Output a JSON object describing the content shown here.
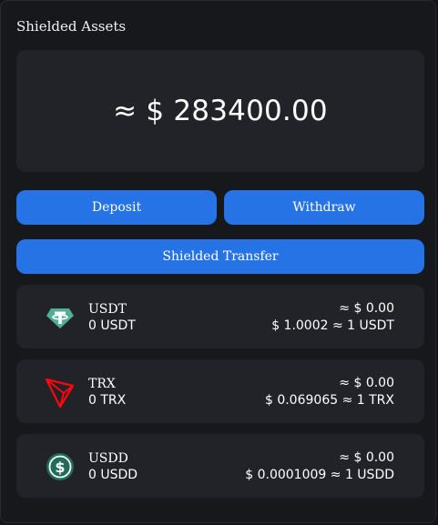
{
  "header": {
    "title": "Shielded Assets"
  },
  "balance": {
    "total": "≈ $ 283400.00"
  },
  "actions": {
    "deposit_label": "Deposit",
    "withdraw_label": "Withdraw",
    "transfer_label": "Shielded Transfer"
  },
  "colors": {
    "accent": "#2673e6",
    "card": "#212329",
    "background": "#17181c",
    "usdt_green": "#50af95",
    "trx_red": "#ff060a",
    "usdd_green": "#216c58"
  },
  "assets": [
    {
      "icon": "tether-icon",
      "symbol": "USDT",
      "balance": "0 USDT",
      "value": "≈ $ 0.00",
      "rate": "$ 1.0002 ≈ 1 USDT"
    },
    {
      "icon": "tron-icon",
      "symbol": "TRX",
      "balance": "0 TRX",
      "value": "≈ $ 0.00",
      "rate": "$ 0.069065 ≈ 1 TRX"
    },
    {
      "icon": "usdd-icon",
      "symbol": "USDD",
      "balance": "0 USDD",
      "value": "≈ $ 0.00",
      "rate": "$ 0.0001009 ≈ 1 USDD"
    }
  ]
}
